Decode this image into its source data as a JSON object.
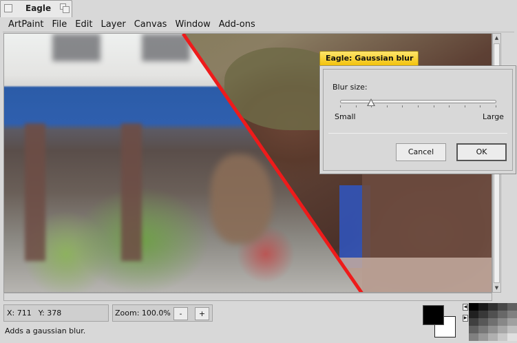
{
  "window": {
    "title": "Eagle"
  },
  "menu": {
    "items": [
      "ArtPaint",
      "File",
      "Edit",
      "Layer",
      "Canvas",
      "Window",
      "Add-ons"
    ]
  },
  "status": {
    "x_label": "X: 711",
    "y_label": "Y: 378",
    "zoom_label": "Zoom: 100.0%",
    "zoom_out": "-",
    "zoom_in": "+",
    "message": "Adds a gaussian blur."
  },
  "colors": {
    "foreground": "#000000",
    "background": "#ffffff",
    "split_line": "#ee1b1b",
    "dialog_tab": "#f2c20b",
    "palette": [
      "#000000",
      "#181818",
      "#303030",
      "#484848",
      "#606060",
      "#202020",
      "#383838",
      "#505050",
      "#686868",
      "#808080",
      "#404040",
      "#585858",
      "#707070",
      "#888888",
      "#a0a0a0",
      "#606060",
      "#787878",
      "#909090",
      "#a8a8a8",
      "#c0c0c0",
      "#808080",
      "#989898",
      "#b0b0b0",
      "#c8c8c8",
      "#e0e0e0"
    ]
  },
  "dialog": {
    "title": "Eagle: Gaussian blur",
    "blur_size_label": "Blur size:",
    "slider_value_fraction": 0.2,
    "small_label": "Small",
    "large_label": "Large",
    "cancel_label": "Cancel",
    "ok_label": "OK"
  }
}
